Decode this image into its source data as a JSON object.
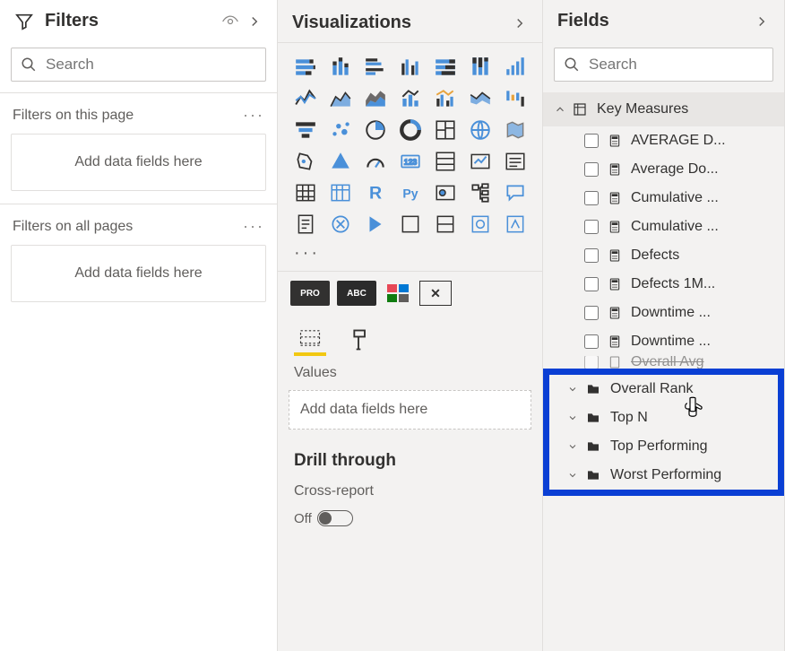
{
  "filters": {
    "title": "Filters",
    "search_placeholder": "Search",
    "sections": [
      {
        "label": "Filters on this page",
        "drop_text": "Add data fields here"
      },
      {
        "label": "Filters on all pages",
        "drop_text": "Add data fields here"
      }
    ]
  },
  "viz": {
    "title": "Visualizations",
    "more": "···",
    "values_label": "Values",
    "values_drop": "Add data fields here",
    "drill_title": "Drill through",
    "cross_report": "Cross-report",
    "toggle_state": "Off",
    "pill_labels": [
      "PRO",
      "ABC"
    ]
  },
  "fields": {
    "title": "Fields",
    "search_placeholder": "Search",
    "table_name": "Key Measures",
    "measures": [
      "AVERAGE D...",
      "Average Do...",
      "Cumulative ...",
      "Cumulative ...",
      "Defects",
      "Defects 1M...",
      "Downtime ...",
      "Downtime ...",
      "Overall Avg"
    ],
    "folders": [
      "Overall Rank",
      "Top N",
      "Top Performing",
      "Worst Performing"
    ]
  }
}
